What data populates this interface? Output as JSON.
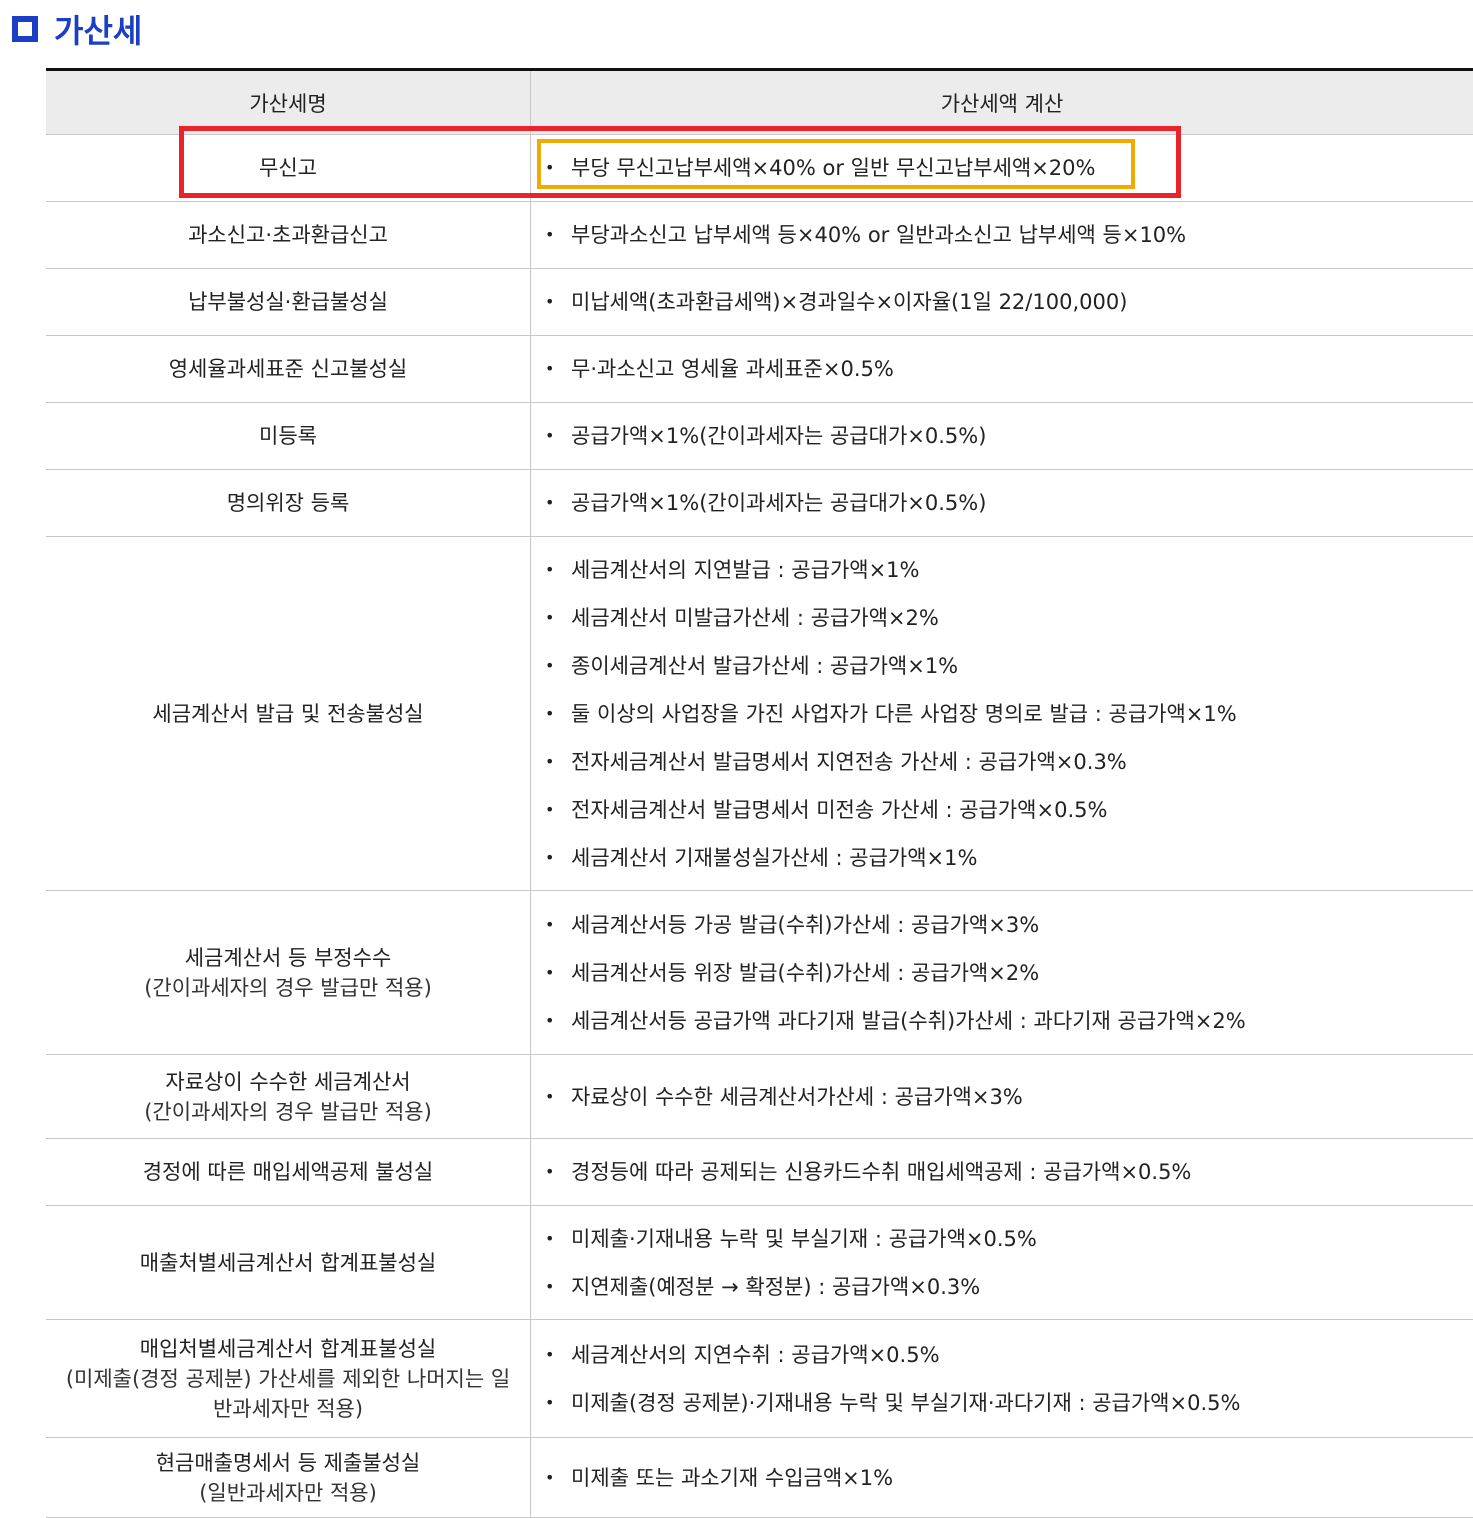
{
  "heading": {
    "title": "가산세"
  },
  "table": {
    "headers": [
      "가산세명",
      "가산세액 계산"
    ],
    "rows": [
      {
        "name": "무신고",
        "sub": "",
        "items": [
          "부당 무신고납부세액×40% or 일반 무신고납부세액×20%"
        ]
      },
      {
        "name": "과소신고·초과환급신고",
        "sub": "",
        "items": [
          "부당과소신고 납부세액 등×40% or 일반과소신고 납부세액 등×10%"
        ]
      },
      {
        "name": "납부불성실·환급불성실",
        "sub": "",
        "items": [
          "미납세액(초과환급세액)×경과일수×이자율(1일 22/100,000)"
        ]
      },
      {
        "name": "영세율과세표준 신고불성실",
        "sub": "",
        "items": [
          "무·과소신고 영세율 과세표준×0.5%"
        ]
      },
      {
        "name": "미등록",
        "sub": "",
        "items": [
          "공급가액×1%(간이과세자는 공급대가×0.5%)"
        ]
      },
      {
        "name": "명의위장 등록",
        "sub": "",
        "items": [
          "공급가액×1%(간이과세자는 공급대가×0.5%)"
        ]
      },
      {
        "name": "세금계산서 발급 및 전송불성실",
        "sub": "",
        "items": [
          "세금계산서의 지연발급 : 공급가액×1%",
          "세금계산서 미발급가산세 : 공급가액×2%",
          "종이세금계산서 발급가산세 : 공급가액×1%",
          "둘 이상의 사업장을 가진 사업자가 다른 사업장 명의로 발급 : 공급가액×1%",
          "전자세금계산서 발급명세서 지연전송 가산세 : 공급가액×0.3%",
          "전자세금계산서 발급명세서 미전송 가산세 : 공급가액×0.5%",
          "세금계산서 기재불성실가산세 : 공급가액×1%"
        ]
      },
      {
        "name": "세금계산서 등 부정수수",
        "sub": "(간이과세자의 경우 발급만 적용)",
        "items": [
          "세금계산서등 가공 발급(수취)가산세 : 공급가액×3%",
          "세금계산서등 위장 발급(수취)가산세 : 공급가액×2%",
          "세금계산서등 공급가액 과다기재 발급(수취)가산세 : 과다기재 공급가액×2%"
        ]
      },
      {
        "name": "자료상이 수수한 세금계산서",
        "sub": "(간이과세자의 경우 발급만 적용)",
        "items": [
          "자료상이 수수한 세금계산서가산세 : 공급가액×3%"
        ]
      },
      {
        "name": "경정에 따른 매입세액공제 불성실",
        "sub": "",
        "items": [
          "경정등에 따라 공제되는 신용카드수취 매입세액공제 : 공급가액×0.5%"
        ]
      },
      {
        "name": "매출처별세금계산서 합계표불성실",
        "sub": "",
        "items": [
          "미제출·기재내용 누락 및 부실기재 : 공급가액×0.5%",
          "지연제출(예정분 → 확정분) : 공급가액×0.3%"
        ]
      },
      {
        "name": "매입처별세금계산서 합계표불성실",
        "sub": "(미제출(경정 공제분) 가산세를 제외한 나머지는 일반과세자만 적용)",
        "items": [
          "세금계산서의 지연수취 : 공급가액×0.5%",
          "미제출(경정 공제분)·기재내용 누락 및 부실기재·과다기재 : 공급가액×0.5%"
        ]
      },
      {
        "name": "현금매출명세서 등 제출불성실",
        "sub": "(일반과세자만 적용)",
        "items": [
          "미제출 또는 과소기재 수입금액×1%"
        ]
      }
    ]
  },
  "highlight_colors": {
    "red": "#e8232a",
    "orange": "#f2a900"
  },
  "accent_color": "#1a3ec4"
}
